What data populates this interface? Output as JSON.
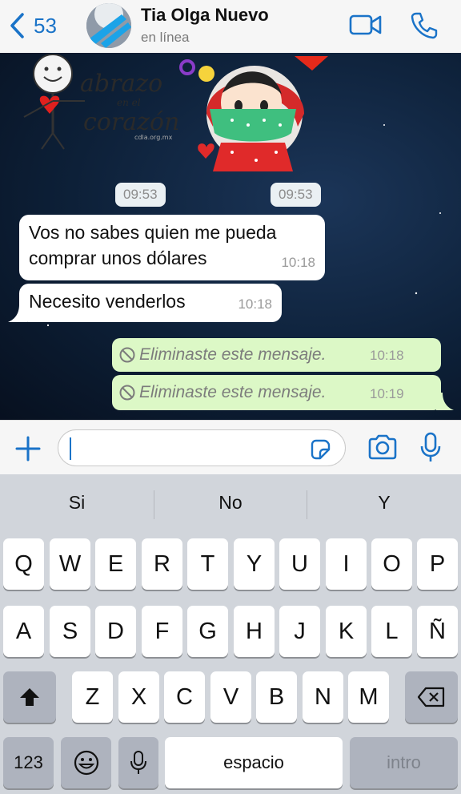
{
  "header": {
    "back_count": "53",
    "contact_name": "Tia Olga Nuevo",
    "status": "en línea"
  },
  "wallpaper_text": {
    "line1": "abrazo",
    "line2": "en el",
    "line3": "corazón",
    "credit": "cdla.org.mx"
  },
  "chat": {
    "system_times": [
      "09:53",
      "09:53"
    ],
    "incoming": [
      {
        "text_line1": "Vos no sabes quien me pueda",
        "text_line2": "comprar unos dólares",
        "time": "10:18"
      },
      {
        "text_line1": "Necesito venderlos",
        "time": "10:18"
      }
    ],
    "outgoing": [
      {
        "text": "Eliminaste este mensaje.",
        "time": "10:18"
      },
      {
        "text": "Eliminaste este mensaje.",
        "time": "10:19"
      }
    ]
  },
  "input": {
    "placeholder": ""
  },
  "keyboard": {
    "suggestions": [
      "Si",
      "No",
      "Y"
    ],
    "row1": [
      "Q",
      "W",
      "E",
      "R",
      "T",
      "Y",
      "U",
      "I",
      "O",
      "P"
    ],
    "row2": [
      "A",
      "S",
      "D",
      "F",
      "G",
      "H",
      "J",
      "K",
      "L",
      "Ñ"
    ],
    "row3": [
      "Z",
      "X",
      "C",
      "V",
      "B",
      "N",
      "M"
    ],
    "numbers_key": "123",
    "space_key": "espacio",
    "return_key": "intro"
  },
  "colors": {
    "accent": "#1a73c8",
    "outgoing_bubble": "#dcf8c6",
    "incoming_bubble": "#ffffff",
    "chat_background": "#0d2038"
  },
  "icons": [
    "chevron-left-icon",
    "video-call-icon",
    "phone-icon",
    "plus-icon",
    "sticker-icon",
    "camera-icon",
    "microphone-icon",
    "blocked-icon",
    "shift-icon",
    "backspace-icon",
    "emoji-icon",
    "dictation-icon"
  ]
}
